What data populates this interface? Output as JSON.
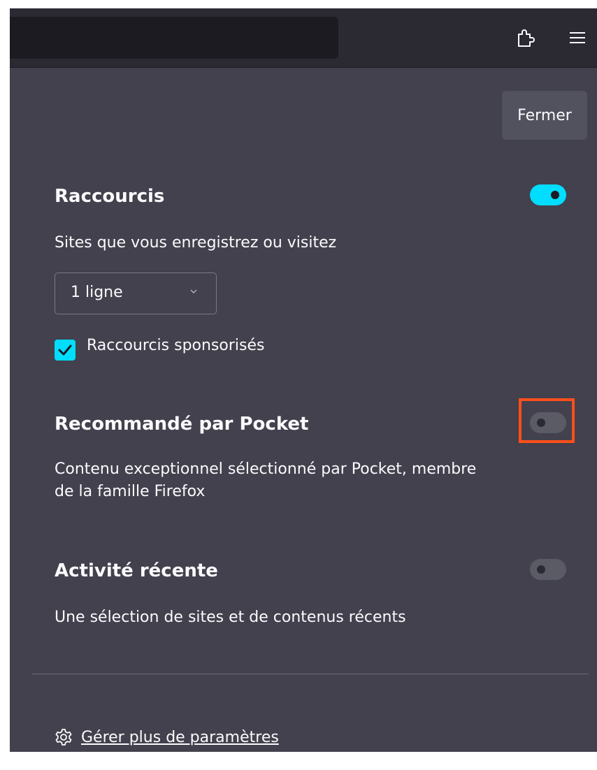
{
  "toolbar": {
    "extensions_icon": "extensions-icon",
    "menu_icon": "hamburger-menu-icon"
  },
  "panel": {
    "close_label": "Fermer"
  },
  "shortcuts": {
    "title": "Raccourcis",
    "description": "Sites que vous enregistrez ou visitez",
    "enabled": true,
    "rows_select_value": "1 ligne",
    "sponsored_label": "Raccourcis sponsorisés",
    "sponsored_checked": true
  },
  "pocket": {
    "title": "Recommandé par Pocket",
    "description_line1": "Contenu exceptionnel sélectionné par Pocket, membre",
    "description_line2": "de la famille Firefox",
    "enabled": false
  },
  "recent": {
    "title": "Activité récente",
    "description": "Une sélection de sites et de contenus récents",
    "enabled": false
  },
  "footer": {
    "manage_link": "Gérer plus de paramètres"
  },
  "colors": {
    "panel_bg": "#42414d",
    "toolbar_bg": "#2b2a33",
    "accent": "#00ddff",
    "highlight": "#ff4f1a"
  }
}
